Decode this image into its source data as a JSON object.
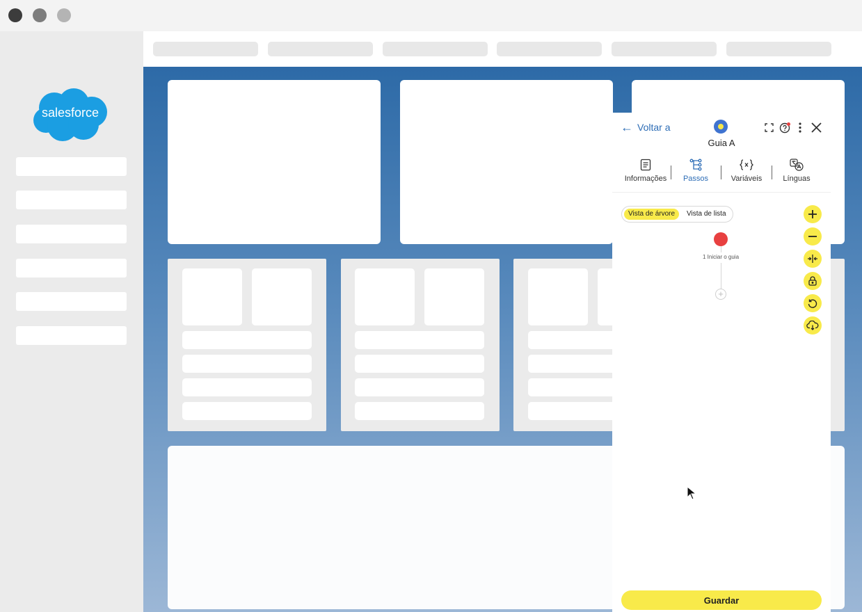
{
  "window": {
    "buttons": [
      {
        "name": "close",
        "color": "#3c3c3c"
      },
      {
        "name": "minimize",
        "color": "#7d7d7d"
      },
      {
        "name": "maximize",
        "color": "#b4b4b4"
      }
    ]
  },
  "brand": {
    "logo_text": "salesforce",
    "logo_color": "#1b9ee2"
  },
  "guide_panel": {
    "back_label": "Voltar a",
    "guide_name": "Guia A",
    "header_icons": [
      "expand-icon",
      "help-icon",
      "more-vertical-icon",
      "close-icon"
    ],
    "tabs": [
      {
        "label": "Informações",
        "icon": "document-icon",
        "active": false
      },
      {
        "label": "Passos",
        "icon": "tree-steps-icon",
        "active": true
      },
      {
        "label": "Variáveis",
        "icon": "variables-icon",
        "active": false
      },
      {
        "label": "Línguas",
        "icon": "languages-icon",
        "active": false
      }
    ],
    "view_toggle": {
      "options": [
        "Vista de árvore",
        "Vista de lista"
      ],
      "selected": "Vista de árvore"
    },
    "tools": [
      "zoom-in-icon",
      "zoom-out-icon",
      "fit-icon",
      "lock-icon",
      "undo-icon",
      "cloud-download-icon"
    ],
    "tree": {
      "start_label": "1 Iniciar o guia"
    },
    "save_label": "Guardar",
    "accent_color": "#f8ea4a",
    "link_color": "#2d6db6",
    "start_node_color": "#e84040"
  }
}
